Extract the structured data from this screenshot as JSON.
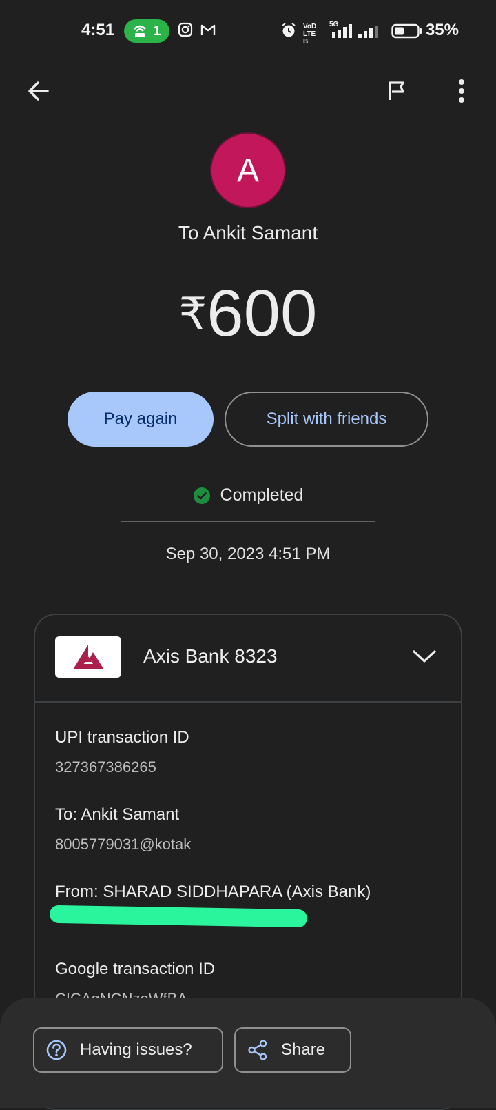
{
  "status_bar": {
    "time": "4:51",
    "hotspot_count": "1",
    "battery": "35%",
    "network_label_top": "VoD",
    "network_label_bottom": "LTE B",
    "network_type": "5G"
  },
  "header": {
    "back_icon": "arrow-back-icon",
    "flag_icon": "flag-icon",
    "more_icon": "more-vert-icon"
  },
  "payee": {
    "avatar_letter": "A",
    "to_label": "To Ankit Samant"
  },
  "amount": {
    "currency": "₹",
    "value": "600"
  },
  "actions": {
    "pay_again": "Pay again",
    "split": "Split with friends"
  },
  "status": {
    "label": "Completed",
    "datetime": "Sep 30, 2023 4:51 PM",
    "color": "#1e8e3e"
  },
  "details": {
    "bank_name": "Axis Bank 8323",
    "upi_label": "UPI transaction ID",
    "upi_value": "327367386265",
    "to_label": "To: Ankit Samant",
    "to_value": "8005779031@kotak",
    "from_label": "From: SHARAD SIDDHAPARA (Axis Bank)",
    "google_label": "Google transaction ID",
    "google_value": "CICAgNCNzeWfBA"
  },
  "bottom": {
    "issues": "Having issues?",
    "share": "Share"
  },
  "colors": {
    "background": "#202020",
    "accent": "#a8c7fa",
    "avatar": "#c2185b",
    "bank_logo": "#ad1f4b"
  }
}
